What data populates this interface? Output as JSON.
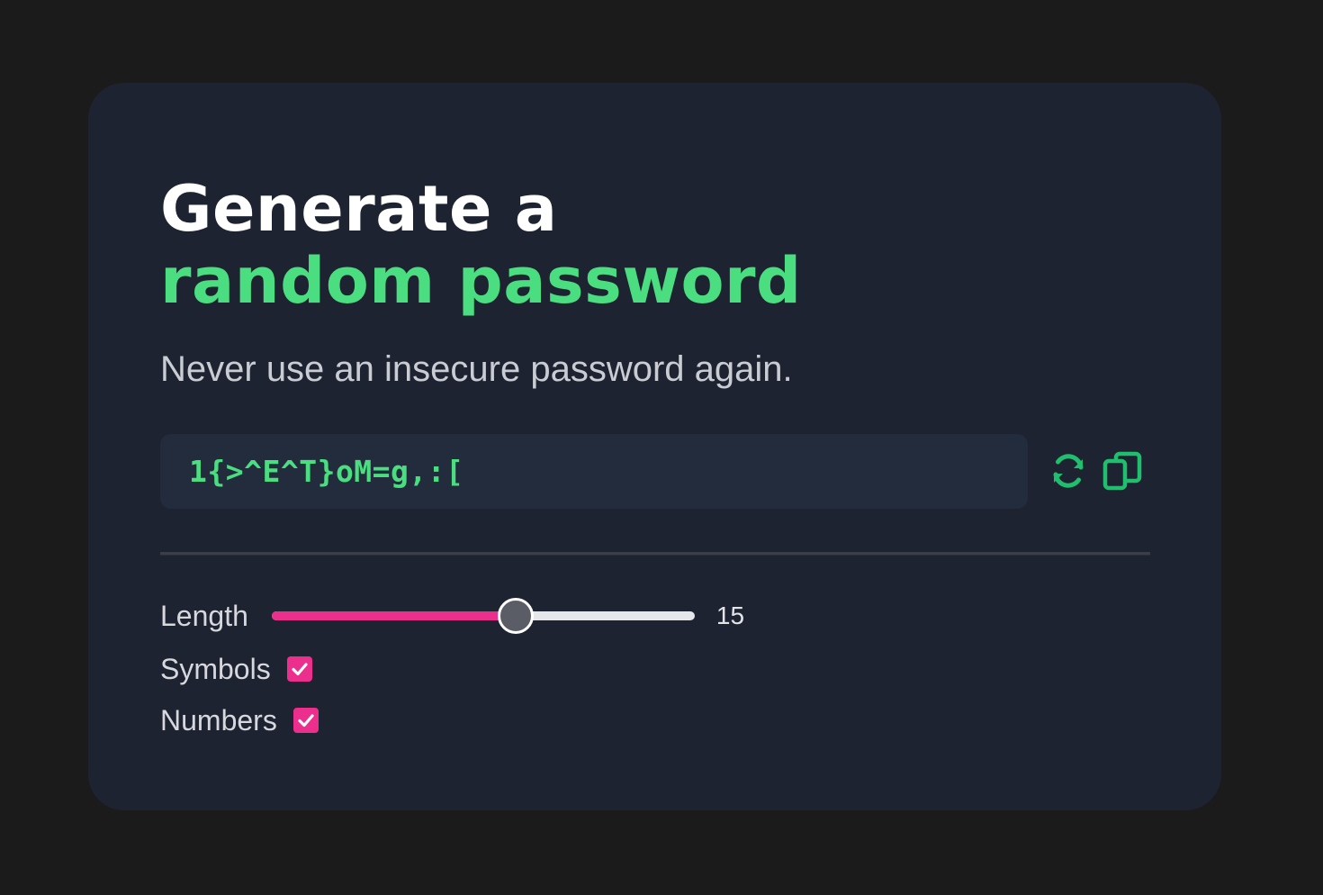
{
  "heading": {
    "line1": "Generate a",
    "line2": "random password"
  },
  "subtitle": "Never use an insecure password again.",
  "password": {
    "value": "1{>^E^T}oM=g,:["
  },
  "actions": {
    "refresh_icon": "refresh-icon",
    "copy_icon": "copy-icon"
  },
  "options": {
    "length": {
      "label": "Length",
      "value": "15",
      "fill_fraction": 0.575
    },
    "symbols": {
      "label": "Symbols",
      "checked": true
    },
    "numbers": {
      "label": "Numbers",
      "checked": true
    }
  },
  "colors": {
    "accent_green": "#4ade80",
    "accent_pink": "#ec2f8c",
    "icon_green": "#1fbf6e",
    "card_bg": "#1e2331",
    "page_bg": "#1b1b1b"
  }
}
